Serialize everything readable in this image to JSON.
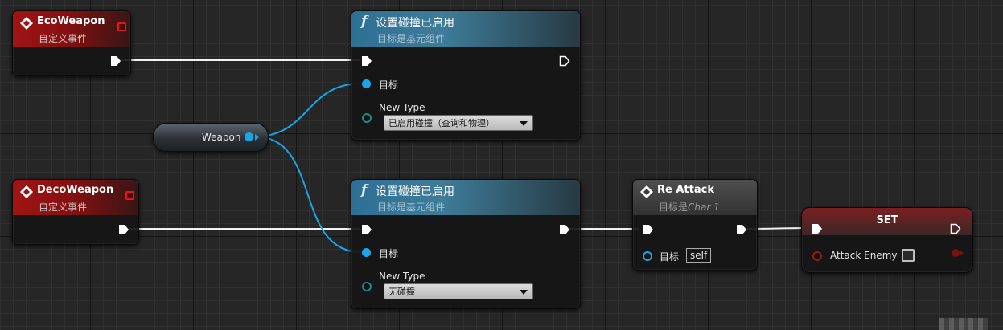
{
  "colors": {
    "event_header": "#a01414",
    "function_header": "#2e6f95",
    "object_pin": "#19a6e8",
    "enum_pin": "#1d8a85",
    "bool_pin": "#9a1818",
    "wire_exec": "#ffffff",
    "wire_object": "#19a6e8"
  },
  "nodes": {
    "eco_event": {
      "title": "EcoWeapon",
      "subtitle": "自定义事件",
      "icon": "event-diamond-icon"
    },
    "deco_event": {
      "title": "DecoWeapon",
      "subtitle": "自定义事件",
      "icon": "event-diamond-icon"
    },
    "weapon_var": {
      "label": "Weapon"
    },
    "set_collision_1": {
      "title": "设置碰撞已启用",
      "subtitle": "目标是基元组件",
      "icon": "function-f-icon",
      "target_label": "目标",
      "new_type_label": "New Type",
      "new_type_value": "已启用碰撞（查询和物理）"
    },
    "set_collision_2": {
      "title": "设置碰撞已启用",
      "subtitle": "目标是基元组件",
      "icon": "function-f-icon",
      "target_label": "目标",
      "new_type_label": "New Type",
      "new_type_value": "无碰撞"
    },
    "re_attack": {
      "title": "Re Attack",
      "subtitle_prefix": "目标是",
      "subtitle_class": "Char 1",
      "icon": "event-diamond-icon",
      "target_label": "目标",
      "target_value": "self"
    },
    "set_attack_enemy": {
      "title": "SET",
      "var_label": "Attack Enemy",
      "checked": false
    }
  }
}
